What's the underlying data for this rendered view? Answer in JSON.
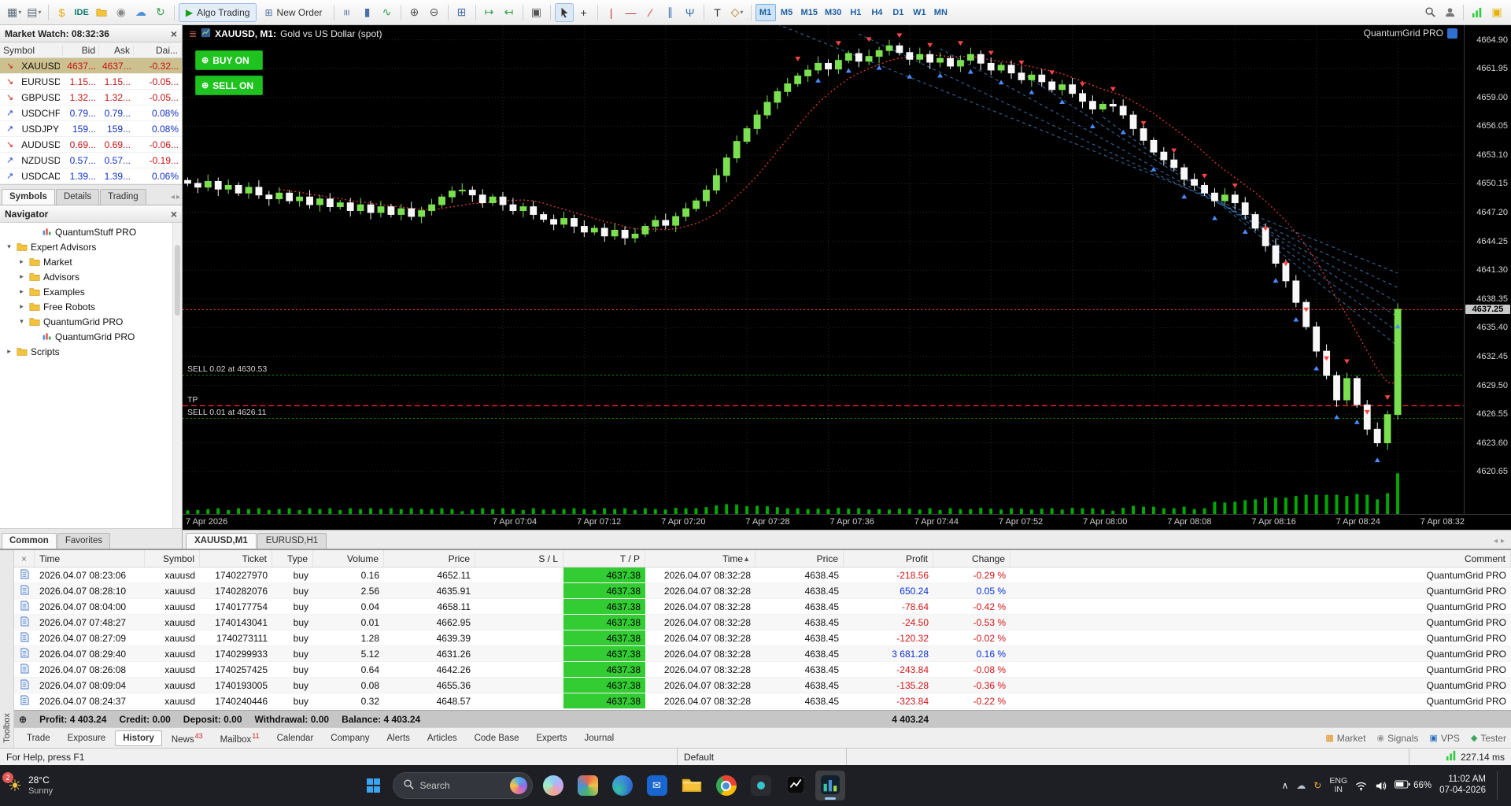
{
  "toolbar": {
    "timeframes": [
      "M1",
      "M5",
      "M15",
      "M30",
      "H1",
      "H4",
      "D1",
      "W1",
      "MN"
    ],
    "active_timeframe": "M1",
    "items": [
      {
        "name": "new-chart-button",
        "glyph": "▦",
        "fg": "#5a6b7a",
        "dd": true
      },
      {
        "name": "chart-profiles-button",
        "glyph": "▤",
        "fg": "#5a6b7a",
        "dd": true
      },
      {
        "sep": true
      },
      {
        "name": "market-watch-button",
        "glyph": "$",
        "fg": "#e7a600"
      },
      {
        "name": "ide-button",
        "text": "IDE",
        "fg": "#0b7d6e"
      },
      {
        "name": "data-folder-button",
        "icon": "folder"
      },
      {
        "name": "record-button",
        "glyph": "◉",
        "fg": "#8a8a8a"
      },
      {
        "name": "cloud-button",
        "glyph": "☁",
        "fg": "#4a90d9"
      },
      {
        "name": "community-button",
        "glyph": "↻",
        "fg": "#2f9e44"
      },
      {
        "sep": true
      },
      {
        "name": "algo-trading-button",
        "glyph": "▶",
        "fg": "#17a317",
        "label": "Algo Trading",
        "pressed": true
      },
      {
        "name": "new-order-button",
        "glyph": "⊞",
        "fg": "#4a6fa5",
        "label": "New Order"
      },
      {
        "sep": true
      },
      {
        "name": "bar-chart-button",
        "glyph": "≡",
        "fg": "#4a6fa5",
        "rot": true
      },
      {
        "name": "candlestick-chart-button",
        "glyph": "▮",
        "fg": "#4a6fa5"
      },
      {
        "name": "line-chart-button",
        "glyph": "∿",
        "fg": "#2f9e44"
      },
      {
        "sep": true
      },
      {
        "name": "zoom-in-button",
        "glyph": "⊕",
        "fg": "#555555"
      },
      {
        "name": "zoom-out-button",
        "glyph": "⊖",
        "fg": "#555555"
      },
      {
        "sep": true
      },
      {
        "name": "tile-windows-button",
        "glyph": "⊞",
        "fg": "#4a6fa5"
      },
      {
        "sep": true
      },
      {
        "name": "auto-scroll-button",
        "glyph": "↦",
        "fg": "#2f9e44"
      },
      {
        "name": "chart-shift-button",
        "glyph": "↤",
        "fg": "#2f9e44"
      },
      {
        "sep": true
      },
      {
        "name": "screenshot-button",
        "glyph": "▣",
        "fg": "#555555"
      },
      {
        "sep": true
      },
      {
        "name": "cursor-tool-button",
        "icon": "cursor",
        "selected": true
      },
      {
        "name": "crosshair-tool-button",
        "glyph": "+",
        "fg": "#333333"
      },
      {
        "sep": true
      },
      {
        "name": "vertical-line-tool-button",
        "glyph": "|",
        "fg": "#c03030"
      },
      {
        "name": "horizontal-line-tool-button",
        "glyph": "—",
        "fg": "#c03030"
      },
      {
        "name": "trendline-tool-button",
        "glyph": "∕",
        "fg": "#c03030"
      },
      {
        "name": "channel-tool-button",
        "glyph": "∥",
        "fg": "#3b6fb5"
      },
      {
        "name": "pitchfork-tool-button",
        "glyph": "Ψ",
        "fg": "#3b6fb5"
      },
      {
        "sep": true
      },
      {
        "name": "text-tool-button",
        "glyph": "T",
        "fg": "#333333"
      },
      {
        "name": "shapes-tool-button",
        "glyph": "◇",
        "fg": "#b06a00",
        "dd": true
      },
      {
        "sep": true
      },
      {
        "tf": true
      },
      {
        "spacer": true
      },
      {
        "name": "search-button",
        "icon": "search"
      },
      {
        "name": "account-button",
        "icon": "person"
      },
      {
        "sep": true
      },
      {
        "name": "connection-levels-icon",
        "icon": "levels"
      },
      {
        "name": "promo-badge-icon",
        "glyph": "▣",
        "fg": "#e7b000"
      }
    ]
  },
  "market_watch": {
    "title": "Market Watch: 08:32:36",
    "columns": [
      "Symbol",
      "Bid",
      "Ask",
      "Dai..."
    ],
    "rows": [
      {
        "symbol": "XAUUSD",
        "bid": "4637...",
        "ask": "4637...",
        "change": "-0.32...",
        "dir": "down",
        "selected": true
      },
      {
        "symbol": "EURUSD",
        "bid": "1.15...",
        "ask": "1.15...",
        "change": "-0.05...",
        "dir": "down"
      },
      {
        "symbol": "GBPUSD",
        "bid": "1.32...",
        "ask": "1.32...",
        "change": "-0.05...",
        "dir": "down"
      },
      {
        "symbol": "USDCHF",
        "bid": "0.79...",
        "ask": "0.79...",
        "change": "0.08%",
        "dir": "up"
      },
      {
        "symbol": "USDJPY",
        "bid": "159...",
        "ask": "159...",
        "change": "0.08%",
        "dir": "up"
      },
      {
        "symbol": "AUDUSD",
        "bid": "0.69...",
        "ask": "0.69...",
        "change": "-0.06...",
        "dir": "down"
      },
      {
        "symbol": "NZDUSD",
        "bid": "0.57...",
        "ask": "0.57...",
        "change": "-0.19...",
        "dir": "up"
      },
      {
        "symbol": "USDCAD",
        "bid": "1.39...",
        "ask": "1.39...",
        "change": "0.06%",
        "dir": "up"
      }
    ],
    "tabs": [
      "Symbols",
      "Details",
      "Trading"
    ],
    "active_tab": "Symbols"
  },
  "navigator": {
    "title": "Navigator",
    "tree": [
      {
        "label": "QuantumStuff PRO",
        "depth": 2,
        "icon": "ea",
        "arrow": "none"
      },
      {
        "label": "Expert Advisors",
        "depth": 0,
        "icon": "folder",
        "arrow": "open"
      },
      {
        "label": "Market",
        "depth": 1,
        "icon": "folder",
        "arrow": "closed"
      },
      {
        "label": "Advisors",
        "depth": 1,
        "icon": "folder",
        "arrow": "closed"
      },
      {
        "label": "Examples",
        "depth": 1,
        "icon": "folder",
        "arrow": "closed"
      },
      {
        "label": "Free Robots",
        "depth": 1,
        "icon": "folder",
        "arrow": "closed"
      },
      {
        "label": "QuantumGrid PRO",
        "depth": 1,
        "icon": "folder",
        "arrow": "open"
      },
      {
        "label": "QuantumGrid PRO",
        "depth": 2,
        "icon": "ea",
        "arrow": "none"
      },
      {
        "label": "Scripts",
        "depth": 0,
        "icon": "folder",
        "arrow": "closed"
      }
    ],
    "tabs": [
      "Common",
      "Favorites"
    ],
    "active_tab": "Common"
  },
  "chart": {
    "title_symbol": "XAUUSD, M1:",
    "title_desc": "Gold vs US Dollar (spot)",
    "ea_label": "QuantumGrid PRO",
    "buy_button": "BUY ON",
    "sell_button": "SELL ON",
    "price_labels": [
      "4664.90",
      "4661.95",
      "4659.00",
      "4656.05",
      "4653.10",
      "4650.15",
      "4647.20",
      "4644.25",
      "4641.30",
      "4638.35",
      "4635.40",
      "4632.45",
      "4629.50",
      "4626.55",
      "4623.60",
      "4620.65"
    ],
    "current_price": "4637.25",
    "time_labels": [
      "7 Apr 2026",
      "7 Apr 07:04",
      "7 Apr 07:12",
      "7 Apr 07:20",
      "7 Apr 07:28",
      "7 Apr 07:36",
      "7 Apr 07:44",
      "7 Apr 07:52",
      "7 Apr 08:00",
      "7 Apr 08:08",
      "7 Apr 08:16",
      "7 Apr 08:24",
      "7 Apr 08:32"
    ],
    "annotations": [
      {
        "text": "SELL 0.02 at 4630.53",
        "price": 4630.53,
        "line": "sell"
      },
      {
        "text": "TP",
        "price": 4627.4,
        "line": "tp"
      },
      {
        "text": "SELL 0.01 at 4626.11",
        "price": 4626.11,
        "line": "sell"
      }
    ],
    "tabs": [
      "XAUUSD,M1",
      "EURUSD,H1"
    ],
    "active_tab": "XAUUSD,M1"
  },
  "chart_data": {
    "type": "candlestick",
    "symbol": "XAUUSD",
    "timeframe": "M1",
    "title": "XAUUSD, M1: Gold vs US Dollar (spot)",
    "x_start": "2026-04-07 06:33",
    "x_end": "2026-04-07 08:32",
    "y_range": [
      4618.4,
      4666.4
    ],
    "current_bid": 4637.25,
    "current_ask": 4637.38,
    "closes": [
      4650.2,
      4649.8,
      4650.4,
      4649.6,
      4650.0,
      4649.2,
      4649.8,
      4649.0,
      4648.6,
      4649.2,
      4648.4,
      4648.8,
      4648.0,
      4648.6,
      4647.8,
      4648.2,
      4647.4,
      4648.0,
      4647.2,
      4647.8,
      4647.0,
      4647.6,
      4646.8,
      4647.4,
      4648.0,
      4648.8,
      4649.4,
      4649.5,
      4649.0,
      4648.2,
      4648.8,
      4648.0,
      4647.4,
      4647.8,
      4647.0,
      4646.5,
      4646.0,
      4646.6,
      4645.8,
      4645.2,
      4645.6,
      4644.8,
      4645.4,
      4644.6,
      4645.0,
      4645.8,
      4646.4,
      4645.9,
      4646.8,
      4647.6,
      4648.4,
      4649.5,
      4651.0,
      4652.8,
      4654.5,
      4655.8,
      4657.2,
      4658.5,
      4659.6,
      4660.4,
      4661.2,
      4661.8,
      4662.5,
      4661.9,
      4662.8,
      4663.5,
      4662.7,
      4663.2,
      4663.8,
      4664.3,
      4663.6,
      4662.9,
      4663.4,
      4662.6,
      4663.0,
      4662.2,
      4662.8,
      4663.4,
      4662.5,
      4661.8,
      4662.3,
      4661.5,
      4660.8,
      4661.3,
      4660.6,
      4659.8,
      4660.3,
      4659.4,
      4658.6,
      4657.8,
      4658.3,
      4658.1,
      4657.2,
      4655.8,
      4654.6,
      4653.4,
      4652.6,
      4651.8,
      4650.6,
      4650.0,
      4649.2,
      4648.4,
      4649.0,
      4648.2,
      4647.0,
      4645.6,
      4643.8,
      4642.0,
      4640.2,
      4638.0,
      4635.5,
      4633.0,
      4630.5,
      4628.0,
      4630.2,
      4627.5,
      4625.0,
      4623.6,
      4626.5,
      4637.3
    ],
    "time_label_indices": [
      31,
      39,
      47,
      55,
      63,
      71,
      79,
      87,
      95,
      103,
      111,
      119
    ],
    "sell_markers": [
      60,
      64,
      67,
      70,
      73,
      76,
      79,
      82,
      85,
      88,
      91,
      94,
      97,
      100,
      103,
      106,
      108,
      110,
      112,
      114,
      116,
      118
    ],
    "buy_markers": [
      62,
      65,
      68,
      71,
      74,
      77,
      80,
      83,
      86,
      89,
      92,
      95,
      98,
      101,
      104,
      107,
      109,
      111,
      113,
      115,
      117,
      119
    ],
    "rays": [
      [
        58,
        4666.5,
        119,
        4641
      ],
      [
        66,
        4665.5,
        119,
        4639.5
      ],
      [
        74,
        4664.0,
        119,
        4638.0
      ],
      [
        82,
        4661.5,
        119,
        4636.5
      ],
      [
        90,
        4657.0,
        119,
        4635.0
      ],
      [
        98,
        4651.0,
        119,
        4633.5
      ]
    ],
    "colors": {
      "up": "#7be050",
      "down": "#f8f8f8",
      "volume": "#00a800",
      "grid": "#2d2d2d",
      "ray": "#3f7fbf",
      "ma": "#ff4040",
      "bid_line": "#ff4040",
      "sell_line": "#00a000",
      "tp_line": "#ff2222",
      "background": "#000000"
    }
  },
  "history": {
    "columns": [
      "Time",
      "Symbol",
      "Ticket",
      "Type",
      "Volume",
      "Price",
      "S / L",
      "T / P",
      "Time",
      "Price",
      "Profit",
      "Change",
      "Comment"
    ],
    "sort_column_index": 8,
    "rows": [
      [
        "2026.04.07 08:23:06",
        "xauusd",
        "1740227970",
        "buy",
        "0.16",
        "4652.11",
        "",
        "4637.38",
        "2026.04.07 08:32:28",
        "4638.45",
        "-218.56",
        "-0.29 %",
        "QuantumGrid PRO"
      ],
      [
        "2026.04.07 08:28:10",
        "xauusd",
        "1740282076",
        "buy",
        "2.56",
        "4635.91",
        "",
        "4637.38",
        "2026.04.07 08:32:28",
        "4638.45",
        "650.24",
        "0.05 %",
        "QuantumGrid PRO"
      ],
      [
        "2026.04.07 08:04:00",
        "xauusd",
        "1740177754",
        "buy",
        "0.04",
        "4658.11",
        "",
        "4637.38",
        "2026.04.07 08:32:28",
        "4638.45",
        "-78.64",
        "-0.42 %",
        "QuantumGrid PRO"
      ],
      [
        "2026.04.07 07:48:27",
        "xauusd",
        "1740143041",
        "buy",
        "0.01",
        "4662.95",
        "",
        "4637.38",
        "2026.04.07 08:32:28",
        "4638.45",
        "-24.50",
        "-0.53 %",
        "QuantumGrid PRO"
      ],
      [
        "2026.04.07 08:27:09",
        "xauusd",
        "1740273111",
        "buy",
        "1.28",
        "4639.39",
        "",
        "4637.38",
        "2026.04.07 08:32:28",
        "4638.45",
        "-120.32",
        "-0.02 %",
        "QuantumGrid PRO"
      ],
      [
        "2026.04.07 08:29:40",
        "xauusd",
        "1740299933",
        "buy",
        "5.12",
        "4631.26",
        "",
        "4637.38",
        "2026.04.07 08:32:28",
        "4638.45",
        "3 681.28",
        "0.16 %",
        "QuantumGrid PRO"
      ],
      [
        "2026.04.07 08:26:08",
        "xauusd",
        "1740257425",
        "buy",
        "0.64",
        "4642.26",
        "",
        "4637.38",
        "2026.04.07 08:32:28",
        "4638.45",
        "-243.84",
        "-0.08 %",
        "QuantumGrid PRO"
      ],
      [
        "2026.04.07 08:09:04",
        "xauusd",
        "1740193005",
        "buy",
        "0.08",
        "4655.36",
        "",
        "4637.38",
        "2026.04.07 08:32:28",
        "4638.45",
        "-135.28",
        "-0.36 %",
        "QuantumGrid PRO"
      ],
      [
        "2026.04.07 08:24:37",
        "xauusd",
        "1740240446",
        "buy",
        "0.32",
        "4648.57",
        "",
        "4637.38",
        "2026.04.07 08:32:28",
        "4638.45",
        "-323.84",
        "-0.22 %",
        "QuantumGrid PRO"
      ]
    ],
    "summary": {
      "segments": [
        "Profit: 4 403.24",
        "Credit: 0.00",
        "Deposit: 0.00",
        "Withdrawal: 0.00",
        "Balance: 4 403.24"
      ],
      "total_profit": "4 403.24"
    }
  },
  "toolbox": {
    "side_label": "Toolbox",
    "tabs": [
      {
        "label": "Trade"
      },
      {
        "label": "Exposure"
      },
      {
        "label": "History",
        "active": true
      },
      {
        "label": "News",
        "badge": "43"
      },
      {
        "label": "Mailbox",
        "badge": "11"
      },
      {
        "label": "Calendar"
      },
      {
        "label": "Company"
      },
      {
        "label": "Alerts"
      },
      {
        "label": "Articles"
      },
      {
        "label": "Code Base"
      },
      {
        "label": "Experts"
      },
      {
        "label": "Journal"
      }
    ],
    "right_items": [
      {
        "label": "Market",
        "icon": "market-icon",
        "color": "#e08a14"
      },
      {
        "label": "Signals",
        "icon": "signals-icon",
        "color": "#9a9a9a"
      },
      {
        "label": "VPS",
        "icon": "vps-icon",
        "color": "#2a6fbd"
      },
      {
        "label": "Tester",
        "icon": "tester-icon",
        "color": "#3ba55c"
      }
    ]
  },
  "status_bar": {
    "help": "For Help, press F1",
    "profile": "Default",
    "latency": "227.14 ms"
  },
  "taskbar": {
    "weather": {
      "badge": "2",
      "temp": "28°C",
      "desc": "Sunny"
    },
    "search_label": "Search",
    "apps": [
      {
        "name": "taskbar-app-copilot",
        "type": "copilot"
      },
      {
        "name": "taskbar-app-photos",
        "type": "photos"
      },
      {
        "name": "taskbar-app-edge",
        "type": "edge"
      },
      {
        "name": "taskbar-app-outlook",
        "type": "outlook"
      },
      {
        "name": "taskbar-app-file-explorer",
        "type": "explorer"
      },
      {
        "name": "taskbar-app-chrome",
        "type": "chrome"
      },
      {
        "name": "taskbar-app-utility",
        "type": "utility"
      },
      {
        "name": "taskbar-app-tradingview",
        "type": "tradingview"
      },
      {
        "name": "taskbar-app-metatrader",
        "type": "metatrader",
        "active": true
      }
    ],
    "tray": {
      "lang_line1": "ENG",
      "lang_line2": "IN",
      "battery": "66%",
      "time": "11:02 AM",
      "date": "07-04-2026"
    }
  }
}
